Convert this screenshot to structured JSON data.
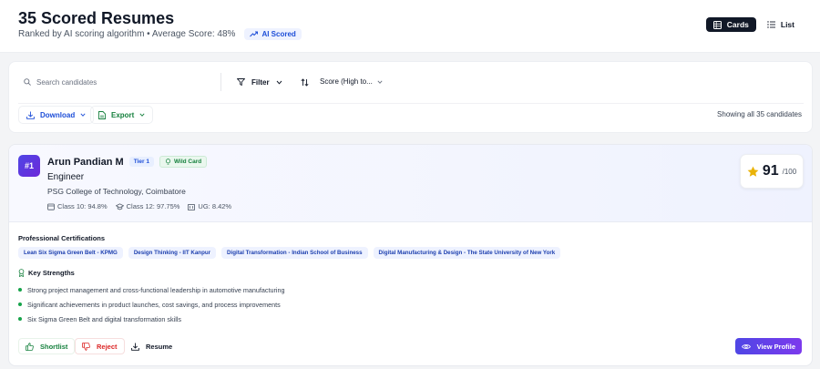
{
  "header": {
    "title": "35 Scored Resumes",
    "subtitle": "Ranked by AI scoring algorithm • Average Score: 48%",
    "ai_badge": "AI Scored",
    "view_cards_label": "Cards",
    "view_list_label": "List"
  },
  "toolbar": {
    "search_placeholder": "Search candidates",
    "filter_label": "Filter",
    "sort_label": "Score (High to...",
    "download_label": "Download",
    "export_label": "Export",
    "showing_text": "Showing all 35 candidates"
  },
  "candidate": {
    "rank": "#1",
    "name": "Arun Pandian M",
    "tier": "Tier 1",
    "wild_card": "Wild Card",
    "role": "Engineer",
    "college": "PSG College of Technology, Coimbatore",
    "class10": "Class 10: 94.8%",
    "class12": "Class 12: 97.75%",
    "ug": "UG: 8.42%",
    "score": "91",
    "score_max": "/100",
    "certifications_title": "Professional Certifications",
    "certifications": [
      "Lean Six Sigma Green Belt - KPMG",
      "Design Thinking - IIT Kanpur",
      "Digital Transformation - Indian School of Business",
      "Digital Manufacturing & Design - The State University of New York"
    ],
    "strengths_title": "Key Strengths",
    "strengths": [
      "Strong project management and cross-functional leadership in automotive manufacturing",
      "Significant achievements in product launches, cost savings, and process improvements",
      "Six Sigma Green Belt and digital transformation skills"
    ],
    "actions": {
      "shortlist": "Shortlist",
      "reject": "Reject",
      "resume": "Resume",
      "view_profile": "View Profile"
    }
  },
  "colors": {
    "accent": "#4f46e5",
    "accent_purple": "#7c3aed",
    "success": "#15803d",
    "danger": "#dc2626",
    "star": "#eab308"
  },
  "icons": [
    "trend-up-icon",
    "grid-icon",
    "list-icon",
    "search-icon",
    "filter-icon",
    "chevron-down-icon",
    "sort-icon",
    "download-icon",
    "file-icon",
    "lightbulb-icon",
    "book-icon",
    "graduation-cap-icon",
    "building-icon",
    "star-icon",
    "award-icon",
    "thumbs-up-icon",
    "thumbs-down-icon",
    "eye-icon"
  ]
}
